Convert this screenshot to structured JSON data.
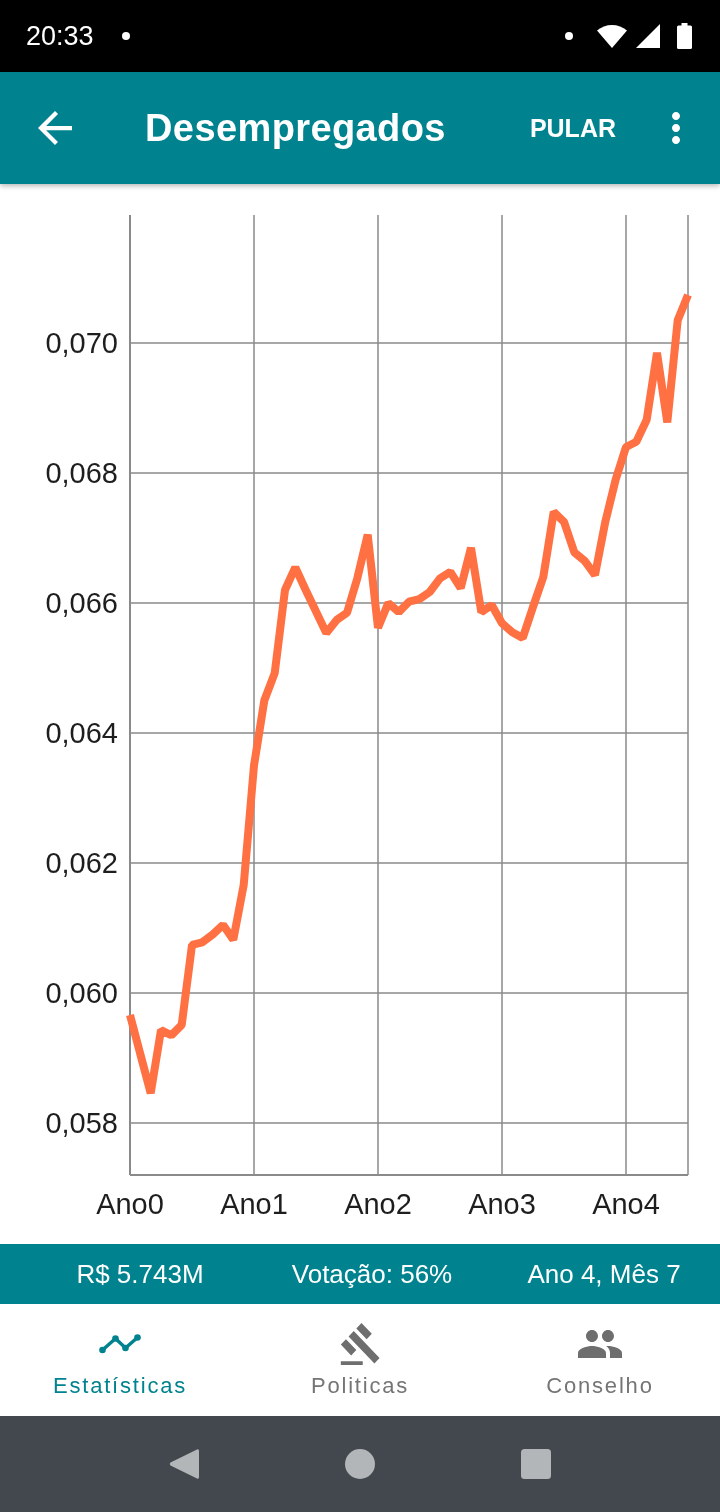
{
  "status_bar": {
    "time": "20:33"
  },
  "app_bar": {
    "title": "Desempregados",
    "action": "PULAR"
  },
  "chart": {
    "chart_data": {
      "type": "line",
      "grid": true,
      "categories": [
        "Ano0",
        null,
        null,
        null,
        null,
        null,
        null,
        null,
        null,
        null,
        null,
        null,
        "Ano1",
        null,
        null,
        null,
        null,
        null,
        null,
        null,
        null,
        null,
        null,
        null,
        "Ano2",
        null,
        null,
        null,
        null,
        null,
        null,
        null,
        null,
        null,
        null,
        null,
        "Ano3",
        null,
        null,
        null,
        null,
        null,
        null,
        null,
        null,
        null,
        null,
        null,
        "Ano4",
        null,
        null,
        null,
        null,
        null,
        null
      ],
      "series": [
        {
          "values": [
            0.05966,
            0.05906,
            0.05846,
            0.05943,
            0.05935,
            0.05951,
            0.06074,
            0.06078,
            0.0609,
            0.06105,
            0.06082,
            0.06166,
            0.0635,
            0.0645,
            0.06492,
            0.0662,
            0.06655,
            0.0662,
            0.06587,
            0.06554,
            0.06574,
            0.06585,
            0.06638,
            0.06705,
            0.06562,
            0.066,
            0.06586,
            0.06602,
            0.06606,
            0.06617,
            0.06638,
            0.06648,
            0.06623,
            0.06685,
            0.06586,
            0.06597,
            0.06569,
            0.06555,
            0.06546,
            0.06594,
            0.0664,
            0.0674,
            0.06725,
            0.06678,
            0.06665,
            0.06643,
            0.06725,
            0.0679,
            0.0684,
            0.06848,
            0.06882,
            0.06985,
            0.06878,
            0.07035,
            0.07074
          ]
        }
      ],
      "ylim": [
        0.0572,
        0.07197
      ],
      "yticks": [
        {
          "value": 0.058,
          "label": "0,058"
        },
        {
          "value": 0.06,
          "label": "0,060"
        },
        {
          "value": 0.062,
          "label": "0,062"
        },
        {
          "value": 0.064,
          "label": "0,064"
        },
        {
          "value": 0.066,
          "label": "0,066"
        },
        {
          "value": 0.068,
          "label": "0,068"
        },
        {
          "value": 0.07,
          "label": "0,070"
        }
      ]
    }
  },
  "info_bar": {
    "items": [
      "R$ 5.743M",
      "Votação: 56%",
      "Ano 4, Mês 7"
    ]
  },
  "bottom_nav": {
    "items": [
      {
        "label": "Estatísticas",
        "selected": true
      },
      {
        "label": "Politicas",
        "selected": false
      },
      {
        "label": "Conselho",
        "selected": false
      }
    ]
  }
}
